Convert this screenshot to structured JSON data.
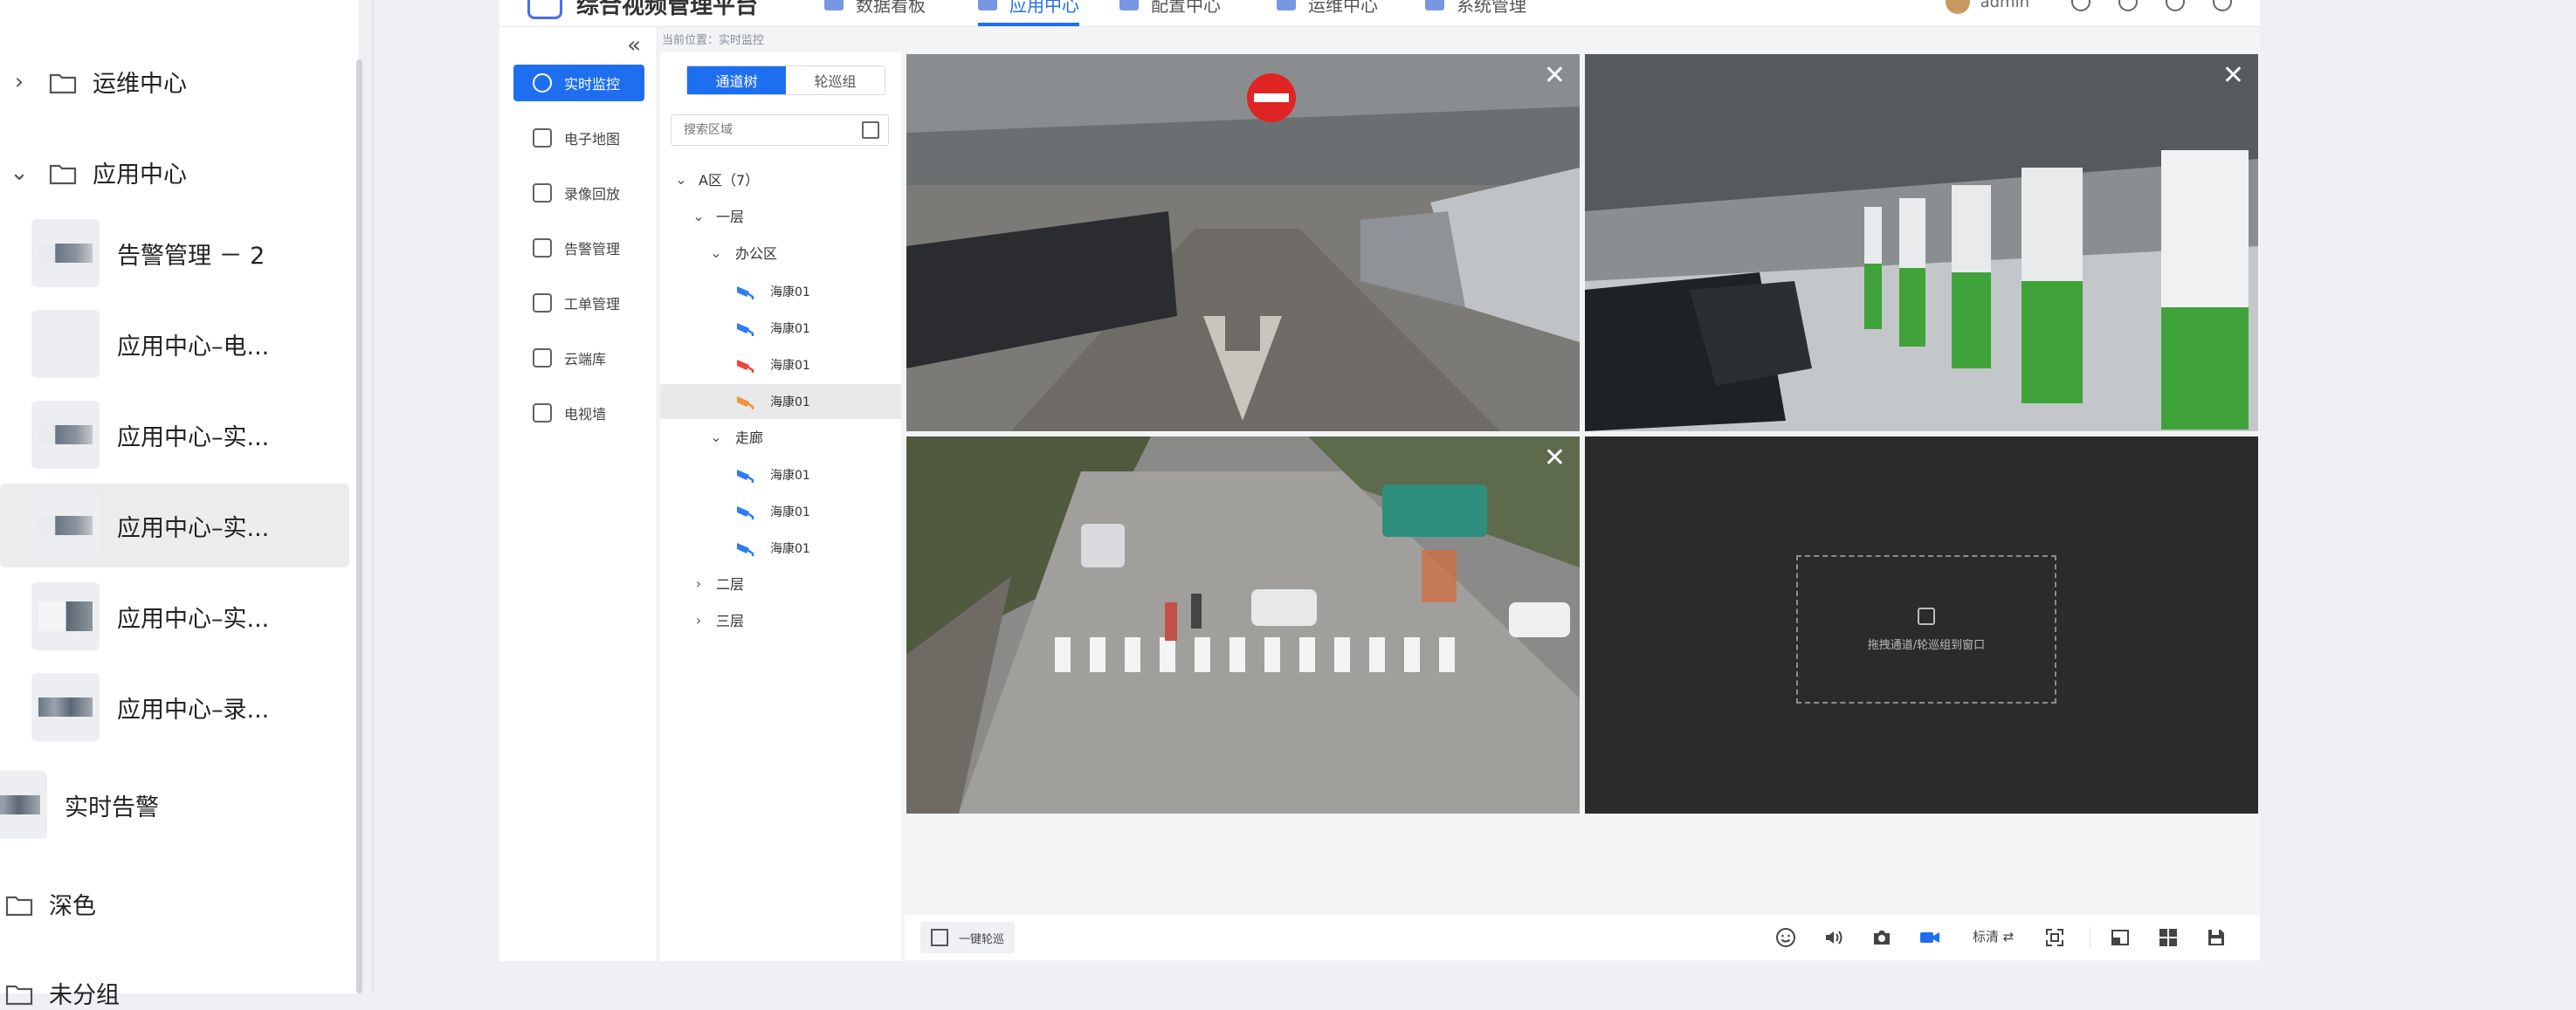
{
  "pages_panel": {
    "folders": [
      {
        "label": "运维中心",
        "expanded": false
      },
      {
        "label": "应用中心",
        "expanded": true
      }
    ],
    "pages": [
      {
        "label": "告警管理 － 2",
        "thumb": "alt"
      },
      {
        "label": "应用中心–电...",
        "thumb": "blank"
      },
      {
        "label": "应用中心–实...",
        "thumb": "alt"
      },
      {
        "label": "应用中心–实...",
        "thumb": "alt",
        "selected": true
      },
      {
        "label": "应用中心–实...",
        "thumb": "white"
      },
      {
        "label": "应用中心–录...",
        "thumb": "strip"
      }
    ],
    "root_page": "实时告警",
    "root_folders": [
      "深色",
      "未分组"
    ]
  },
  "app": {
    "title": "综合视频管理平台",
    "top_tabs": [
      {
        "label": "数据看板"
      },
      {
        "label": "应用中心",
        "active": true
      },
      {
        "label": "配置中心"
      },
      {
        "label": "运维中心"
      },
      {
        "label": "系统管理"
      }
    ],
    "user": "admin",
    "breadcrumb": "当前位置：实时监控",
    "collapse_glyph": "«"
  },
  "sidenav": {
    "items": [
      {
        "label": "实时监控",
        "active": true
      },
      {
        "label": "电子地图"
      },
      {
        "label": "录像回放"
      },
      {
        "label": "告警管理"
      },
      {
        "label": "工单管理"
      },
      {
        "label": "云端库"
      },
      {
        "label": "电视墙"
      }
    ]
  },
  "channel_tree": {
    "tabs": [
      "通道树",
      "轮巡组"
    ],
    "active_tab": 0,
    "search_placeholder": "搜索区域",
    "root": "A区（7）",
    "floor1": "一层",
    "office": "办公区",
    "office_cams": [
      {
        "label": "海康01",
        "status": "online",
        "color": "#2f7cf6"
      },
      {
        "label": "海康01",
        "status": "online",
        "color": "#2f7cf6"
      },
      {
        "label": "海康01",
        "status": "alarm",
        "color": "#e8473e"
      },
      {
        "label": "海康01",
        "status": "warning",
        "color": "#f3913a",
        "selected": true
      }
    ],
    "corridor": "走廊",
    "corridor_cams": [
      {
        "label": "海康01",
        "status": "online",
        "color": "#2f7cf6"
      },
      {
        "label": "海康01",
        "status": "online",
        "color": "#2f7cf6"
      },
      {
        "label": "海康01",
        "status": "online",
        "color": "#2f7cf6"
      }
    ],
    "floor2": "二层",
    "floor3": "三层"
  },
  "video_grid": {
    "layout": "2x2",
    "empty_pane_text": "拖拽通道/轮巡组到窗口"
  },
  "toolbar": {
    "patrol_label": "一键轮巡",
    "quality_label": "标清 ⇄",
    "icons": [
      "smiley-icon",
      "volume-icon",
      "camera-icon",
      "record-icon",
      "fullscreen-icon",
      "window-icon",
      "grid-icon",
      "save-icon"
    ]
  }
}
